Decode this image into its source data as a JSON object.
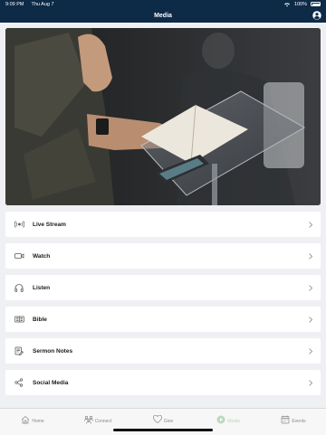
{
  "status_bar": {
    "time": "9:09 PM",
    "date": "Thu Aug 7",
    "battery_percent": "100%",
    "wifi_icon": "wifi-icon",
    "battery_icon": "battery-icon"
  },
  "header": {
    "title": "Media",
    "profile_icon": "person-circle-icon",
    "background_color": "#0d2a47"
  },
  "hero": {
    "image_description_icon": "photo-hands-bible-pulpit"
  },
  "menu": {
    "items": [
      {
        "label": "Live Stream",
        "icon": "broadcast-icon"
      },
      {
        "label": "Watch",
        "icon": "video-camera-icon"
      },
      {
        "label": "Listen",
        "icon": "headphones-icon"
      },
      {
        "label": "Bible",
        "icon": "book-icon"
      },
      {
        "label": "Sermon Notes",
        "icon": "edit-note-icon"
      },
      {
        "label": "Social Media",
        "icon": "share-icon"
      }
    ]
  },
  "tab_bar": {
    "tabs": [
      {
        "label": "Home",
        "icon": "home-icon"
      },
      {
        "label": "Connect",
        "icon": "people-icon"
      },
      {
        "label": "Give",
        "icon": "heart-icon"
      },
      {
        "label": "Media",
        "icon": "play-circle-icon",
        "active": true
      },
      {
        "label": "Events",
        "icon": "calendar-icon"
      }
    ],
    "active_color": "#bcd9bf"
  }
}
